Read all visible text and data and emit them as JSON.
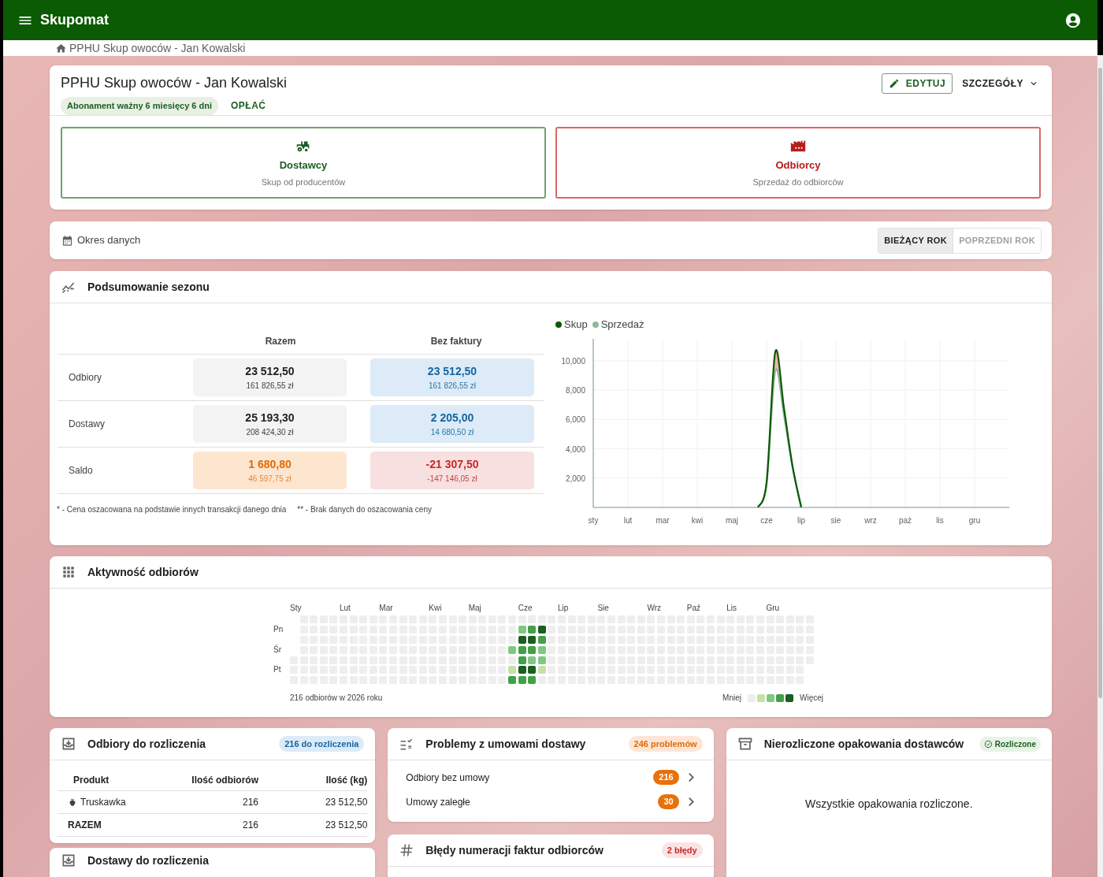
{
  "app_bar": {
    "title": "Skupomat"
  },
  "breadcrumb": {
    "label": "PPHU Skup owoców - Jan Kowalski"
  },
  "company": {
    "name": "PPHU Skup owoców - Jan Kowalski",
    "subscription_badge": "Abonament ważny 6 miesięcy 6 dni",
    "pay_button": "OPŁAĆ",
    "edit_button": "EDYTUJ",
    "details_button": "SZCZEGÓŁY"
  },
  "tiles": [
    {
      "kind": "suppliers",
      "title": "Dostawcy",
      "subtitle": "Skup od producentów"
    },
    {
      "kind": "buyers",
      "title": "Odbiorcy",
      "subtitle": "Sprzedaż do odbiorców"
    }
  ],
  "period": {
    "label": "Okres danych",
    "options": [
      {
        "label": "BIEŻĄCY ROK",
        "selected": true
      },
      {
        "label": "POPRZEDNI ROK",
        "selected": false
      }
    ]
  },
  "season_summary": {
    "title": "Podsumowanie sezonu",
    "columns": [
      "Razem",
      "Bez faktury"
    ],
    "rows": [
      {
        "label": "Odbiory",
        "cells": [
          {
            "kind": "neutral",
            "amount": "23 512,50",
            "value": "161 826,55 zł"
          },
          {
            "kind": "info",
            "amount": "23 512,50",
            "value": "161 826,55 zł"
          }
        ]
      },
      {
        "label": "Dostawy",
        "cells": [
          {
            "kind": "neutral",
            "amount": "25 193,30",
            "value": "208 424,30 zł"
          },
          {
            "kind": "info",
            "amount": "2 205,00",
            "value": "14 680,50 zł"
          }
        ]
      },
      {
        "label": "Saldo",
        "cells": [
          {
            "kind": "warning",
            "amount": "1 680,80",
            "value": "46 597,75 zł"
          },
          {
            "kind": "error",
            "amount": "-21 307,50",
            "value": "-147 146,05 zł"
          }
        ]
      }
    ],
    "footnotes": [
      "* - Cena oszacowana na podstawie innych transakcji danego dnia",
      "** - Brak danych do oszacowania ceny"
    ],
    "chart_data": {
      "type": "line",
      "grid": true,
      "legend": "top-left",
      "ylim": [
        0,
        11500
      ],
      "categories": [
        "sty",
        null,
        null,
        null,
        "lut",
        null,
        null,
        null,
        "mar",
        null,
        null,
        null,
        "kwi",
        null,
        null,
        null,
        "maj",
        null,
        null,
        null,
        "cze",
        null,
        null,
        null,
        "lip",
        null,
        null,
        null,
        "sie",
        null,
        null,
        null,
        "wrz",
        null,
        null,
        null,
        "paż",
        null,
        null,
        null,
        "lis",
        null,
        null,
        null,
        "gru",
        null,
        null,
        null
      ],
      "yticks": [
        {
          "value": 2000,
          "label": "2,000"
        },
        {
          "value": 4000,
          "label": "4,000"
        },
        {
          "value": 6000,
          "label": "6,000"
        },
        {
          "value": 8000,
          "label": "8,000"
        },
        {
          "value": 10000,
          "label": "10,000"
        }
      ],
      "series": [
        {
          "name": "Skup",
          "color": "#0b5a04",
          "values": [
            null,
            null,
            null,
            null,
            null,
            null,
            null,
            null,
            null,
            null,
            null,
            null,
            null,
            null,
            null,
            null,
            null,
            null,
            null,
            0,
            1700,
            10600,
            6800,
            2800,
            0,
            null,
            null,
            null,
            null,
            null,
            null,
            null,
            null,
            null,
            null,
            null,
            null,
            null,
            null,
            null,
            null,
            null,
            null,
            null,
            null,
            null,
            null,
            null
          ]
        },
        {
          "name": "Sprzedaż",
          "color": "#8fb89a",
          "values": [
            null,
            null,
            null,
            null,
            null,
            null,
            null,
            null,
            null,
            null,
            null,
            null,
            null,
            null,
            null,
            null,
            null,
            null,
            null,
            0,
            1600,
            9300,
            6300,
            2700,
            0,
            null,
            null,
            null,
            null,
            null,
            null,
            null,
            null,
            null,
            null,
            null,
            null,
            null,
            null,
            null,
            null,
            null,
            null,
            null,
            null,
            null,
            null,
            null
          ]
        }
      ]
    }
  },
  "activity": {
    "title": "Aktywność odbiorów",
    "months": [
      "Sty",
      "Lut",
      "Mar",
      "Kwi",
      "Maj",
      "Cze",
      "Lip",
      "Sie",
      "Wrz",
      "Paź",
      "Lis",
      "Gru"
    ],
    "day_labels": [
      "Pn",
      "Śr",
      "Pt"
    ],
    "grid": [
      {
        "cells": [
          {
            "color": "#eeeeee"
          },
          {
            "color": "#eeeeee"
          },
          {
            "color": "#eeeeee"
          },
          {
            "color": "#eeeeee"
          },
          {
            "color": "#eeeeee"
          },
          {
            "color": "#eeeeee"
          },
          {
            "color": "#eeeeee"
          },
          {
            "color": "#eeeeee"
          },
          {
            "color": "#eeeeee"
          },
          {
            "color": "#eeeeee"
          },
          {
            "color": "#eeeeee"
          },
          {
            "color": "#eeeeee"
          },
          {
            "color": "#eeeeee"
          },
          {
            "color": "#eeeeee"
          },
          {
            "color": "#eeeeee"
          },
          {
            "color": "#eeeeee"
          },
          {
            "color": "#eeeeee"
          },
          {
            "color": "#eeeeee"
          },
          {
            "color": "#eeeeee"
          },
          {
            "color": "#eeeeee"
          },
          {
            "color": "#eeeeee"
          },
          {
            "color": "#eeeeee"
          },
          {
            "color": "#eeeeee"
          },
          {
            "color": "#eeeeee"
          },
          {
            "color": "#eeeeee"
          },
          {
            "color": "#eeeeee"
          },
          {
            "color": "#eeeeee"
          },
          {
            "color": "#eeeeee"
          },
          {
            "color": "#eeeeee"
          },
          {
            "color": "#eeeeee"
          },
          {
            "color": "#eeeeee"
          },
          {
            "color": "#eeeeee"
          },
          {
            "color": "#eeeeee"
          },
          {
            "color": "#eeeeee"
          },
          {
            "color": "#eeeeee"
          },
          {
            "color": "#eeeeee"
          },
          {
            "color": "#eeeeee"
          },
          {
            "color": "#eeeeee"
          },
          {
            "color": "#eeeeee"
          },
          {
            "color": "#eeeeee"
          },
          {
            "color": "#eeeeee"
          },
          {
            "color": "#eeeeee"
          },
          {
            "color": "#eeeeee"
          },
          {
            "color": "#eeeeee"
          },
          {
            "color": "#eeeeee"
          },
          {
            "color": "#eeeeee"
          },
          {
            "color": "#eeeeee"
          },
          {
            "color": "#eeeeee"
          },
          {
            "color": "#eeeeee"
          },
          {
            "color": "#eeeeee"
          },
          {
            "color": "#eeeeee"
          },
          {
            "color": "#eeeeee"
          }
        ]
      },
      {
        "cells": [
          {
            "color": "#eeeeee"
          },
          {
            "color": "#eeeeee"
          },
          {
            "color": "#eeeeee"
          },
          {
            "color": "#eeeeee"
          },
          {
            "color": "#eeeeee"
          },
          {
            "color": "#eeeeee"
          },
          {
            "color": "#eeeeee"
          },
          {
            "color": "#eeeeee"
          },
          {
            "color": "#eeeeee"
          },
          {
            "color": "#eeeeee"
          },
          {
            "color": "#eeeeee"
          },
          {
            "color": "#eeeeee"
          },
          {
            "color": "#eeeeee"
          },
          {
            "color": "#eeeeee"
          },
          {
            "color": "#eeeeee"
          },
          {
            "color": "#eeeeee"
          },
          {
            "color": "#eeeeee"
          },
          {
            "color": "#eeeeee"
          },
          {
            "color": "#eeeeee"
          },
          {
            "color": "#eeeeee"
          },
          {
            "color": "#eeeeee"
          },
          {
            "color": "#eeeeee"
          },
          {
            "color": "#81c784"
          },
          {
            "color": "#43a047"
          },
          {
            "color": "#1b5e20"
          },
          {
            "color": "#eeeeee"
          },
          {
            "color": "#eeeeee"
          },
          {
            "color": "#eeeeee"
          },
          {
            "color": "#eeeeee"
          },
          {
            "color": "#eeeeee"
          },
          {
            "color": "#eeeeee"
          },
          {
            "color": "#eeeeee"
          },
          {
            "color": "#eeeeee"
          },
          {
            "color": "#eeeeee"
          },
          {
            "color": "#eeeeee"
          },
          {
            "color": "#eeeeee"
          },
          {
            "color": "#eeeeee"
          },
          {
            "color": "#eeeeee"
          },
          {
            "color": "#eeeeee"
          },
          {
            "color": "#eeeeee"
          },
          {
            "color": "#eeeeee"
          },
          {
            "color": "#eeeeee"
          },
          {
            "color": "#eeeeee"
          },
          {
            "color": "#eeeeee"
          },
          {
            "color": "#eeeeee"
          },
          {
            "color": "#eeeeee"
          },
          {
            "color": "#eeeeee"
          },
          {
            "color": "#eeeeee"
          },
          {
            "color": "#eeeeee"
          },
          {
            "color": "#eeeeee"
          },
          {
            "color": "#eeeeee"
          },
          {
            "color": "#eeeeee"
          }
        ]
      },
      {
        "cells": [
          {
            "color": "#eeeeee"
          },
          {
            "color": "#eeeeee"
          },
          {
            "color": "#eeeeee"
          },
          {
            "color": "#eeeeee"
          },
          {
            "color": "#eeeeee"
          },
          {
            "color": "#eeeeee"
          },
          {
            "color": "#eeeeee"
          },
          {
            "color": "#eeeeee"
          },
          {
            "color": "#eeeeee"
          },
          {
            "color": "#eeeeee"
          },
          {
            "color": "#eeeeee"
          },
          {
            "color": "#eeeeee"
          },
          {
            "color": "#eeeeee"
          },
          {
            "color": "#eeeeee"
          },
          {
            "color": "#eeeeee"
          },
          {
            "color": "#eeeeee"
          },
          {
            "color": "#eeeeee"
          },
          {
            "color": "#eeeeee"
          },
          {
            "color": "#eeeeee"
          },
          {
            "color": "#eeeeee"
          },
          {
            "color": "#eeeeee"
          },
          {
            "color": "#eeeeee"
          },
          {
            "color": "#1b5e20"
          },
          {
            "color": "#1b5e20"
          },
          {
            "color": "#43a047"
          },
          {
            "color": "#eeeeee"
          },
          {
            "color": "#eeeeee"
          },
          {
            "color": "#eeeeee"
          },
          {
            "color": "#eeeeee"
          },
          {
            "color": "#eeeeee"
          },
          {
            "color": "#eeeeee"
          },
          {
            "color": "#eeeeee"
          },
          {
            "color": "#eeeeee"
          },
          {
            "color": "#eeeeee"
          },
          {
            "color": "#eeeeee"
          },
          {
            "color": "#eeeeee"
          },
          {
            "color": "#eeeeee"
          },
          {
            "color": "#eeeeee"
          },
          {
            "color": "#eeeeee"
          },
          {
            "color": "#eeeeee"
          },
          {
            "color": "#eeeeee"
          },
          {
            "color": "#eeeeee"
          },
          {
            "color": "#eeeeee"
          },
          {
            "color": "#eeeeee"
          },
          {
            "color": "#eeeeee"
          },
          {
            "color": "#eeeeee"
          },
          {
            "color": "#eeeeee"
          },
          {
            "color": "#eeeeee"
          },
          {
            "color": "#eeeeee"
          },
          {
            "color": "#eeeeee"
          },
          {
            "color": "#eeeeee"
          },
          {
            "color": "#eeeeee"
          }
        ]
      },
      {
        "cells": [
          {
            "color": "#eeeeee"
          },
          {
            "color": "#eeeeee"
          },
          {
            "color": "#eeeeee"
          },
          {
            "color": "#eeeeee"
          },
          {
            "color": "#eeeeee"
          },
          {
            "color": "#eeeeee"
          },
          {
            "color": "#eeeeee"
          },
          {
            "color": "#eeeeee"
          },
          {
            "color": "#eeeeee"
          },
          {
            "color": "#eeeeee"
          },
          {
            "color": "#eeeeee"
          },
          {
            "color": "#eeeeee"
          },
          {
            "color": "#eeeeee"
          },
          {
            "color": "#eeeeee"
          },
          {
            "color": "#eeeeee"
          },
          {
            "color": "#eeeeee"
          },
          {
            "color": "#eeeeee"
          },
          {
            "color": "#eeeeee"
          },
          {
            "color": "#eeeeee"
          },
          {
            "color": "#eeeeee"
          },
          {
            "color": "#eeeeee"
          },
          {
            "color": "#81c784"
          },
          {
            "color": "#43a047"
          },
          {
            "color": "#43a047"
          },
          {
            "color": "#81c784"
          },
          {
            "color": "#eeeeee"
          },
          {
            "color": "#eeeeee"
          },
          {
            "color": "#eeeeee"
          },
          {
            "color": "#eeeeee"
          },
          {
            "color": "#eeeeee"
          },
          {
            "color": "#eeeeee"
          },
          {
            "color": "#eeeeee"
          },
          {
            "color": "#eeeeee"
          },
          {
            "color": "#eeeeee"
          },
          {
            "color": "#eeeeee"
          },
          {
            "color": "#eeeeee"
          },
          {
            "color": "#eeeeee"
          },
          {
            "color": "#eeeeee"
          },
          {
            "color": "#eeeeee"
          },
          {
            "color": "#eeeeee"
          },
          {
            "color": "#eeeeee"
          },
          {
            "color": "#eeeeee"
          },
          {
            "color": "#eeeeee"
          },
          {
            "color": "#eeeeee"
          },
          {
            "color": "#eeeeee"
          },
          {
            "color": "#eeeeee"
          },
          {
            "color": "#eeeeee"
          },
          {
            "color": "#eeeeee"
          },
          {
            "color": "#eeeeee"
          },
          {
            "color": "#eeeeee"
          },
          {
            "color": "#eeeeee"
          },
          {
            "color": "#eeeeee"
          }
        ]
      },
      {
        "cells": [
          {
            "color": "#eeeeee"
          },
          {
            "color": "#eeeeee"
          },
          {
            "color": "#eeeeee"
          },
          {
            "color": "#eeeeee"
          },
          {
            "color": "#eeeeee"
          },
          {
            "color": "#eeeeee"
          },
          {
            "color": "#eeeeee"
          },
          {
            "color": "#eeeeee"
          },
          {
            "color": "#eeeeee"
          },
          {
            "color": "#eeeeee"
          },
          {
            "color": "#eeeeee"
          },
          {
            "color": "#eeeeee"
          },
          {
            "color": "#eeeeee"
          },
          {
            "color": "#eeeeee"
          },
          {
            "color": "#eeeeee"
          },
          {
            "color": "#eeeeee"
          },
          {
            "color": "#eeeeee"
          },
          {
            "color": "#eeeeee"
          },
          {
            "color": "#eeeeee"
          },
          {
            "color": "#eeeeee"
          },
          {
            "color": "#eeeeee"
          },
          {
            "color": "#eeeeee"
          },
          {
            "color": "#eeeeee"
          },
          {
            "color": "#43a047"
          },
          {
            "color": "#81c784"
          },
          {
            "color": "#81c784"
          },
          {
            "color": "#eeeeee"
          },
          {
            "color": "#eeeeee"
          },
          {
            "color": "#eeeeee"
          },
          {
            "color": "#eeeeee"
          },
          {
            "color": "#eeeeee"
          },
          {
            "color": "#eeeeee"
          },
          {
            "color": "#eeeeee"
          },
          {
            "color": "#eeeeee"
          },
          {
            "color": "#eeeeee"
          },
          {
            "color": "#eeeeee"
          },
          {
            "color": "#eeeeee"
          },
          {
            "color": "#eeeeee"
          },
          {
            "color": "#eeeeee"
          },
          {
            "color": "#eeeeee"
          },
          {
            "color": "#eeeeee"
          },
          {
            "color": "#eeeeee"
          },
          {
            "color": "#eeeeee"
          },
          {
            "color": "#eeeeee"
          },
          {
            "color": "#eeeeee"
          },
          {
            "color": "#eeeeee"
          },
          {
            "color": "#eeeeee"
          },
          {
            "color": "#eeeeee"
          },
          {
            "color": "#eeeeee"
          },
          {
            "color": "#eeeeee"
          },
          {
            "color": "#eeeeee"
          },
          {
            "color": "#eeeeee"
          },
          {
            "color": "#eeeeee"
          }
        ]
      },
      {
        "cells": [
          {
            "color": "#eeeeee"
          },
          {
            "color": "#eeeeee"
          },
          {
            "color": "#eeeeee"
          },
          {
            "color": "#eeeeee"
          },
          {
            "color": "#eeeeee"
          },
          {
            "color": "#eeeeee"
          },
          {
            "color": "#eeeeee"
          },
          {
            "color": "#eeeeee"
          },
          {
            "color": "#eeeeee"
          },
          {
            "color": "#eeeeee"
          },
          {
            "color": "#eeeeee"
          },
          {
            "color": "#eeeeee"
          },
          {
            "color": "#eeeeee"
          },
          {
            "color": "#eeeeee"
          },
          {
            "color": "#eeeeee"
          },
          {
            "color": "#eeeeee"
          },
          {
            "color": "#eeeeee"
          },
          {
            "color": "#eeeeee"
          },
          {
            "color": "#eeeeee"
          },
          {
            "color": "#eeeeee"
          },
          {
            "color": "#eeeeee"
          },
          {
            "color": "#eeeeee"
          },
          {
            "color": "#c5e1a5"
          },
          {
            "color": "#1b5e20"
          },
          {
            "color": "#1b5e20"
          },
          {
            "color": "#c5e1a5"
          },
          {
            "color": "#eeeeee"
          },
          {
            "color": "#eeeeee"
          },
          {
            "color": "#eeeeee"
          },
          {
            "color": "#eeeeee"
          },
          {
            "color": "#eeeeee"
          },
          {
            "color": "#eeeeee"
          },
          {
            "color": "#eeeeee"
          },
          {
            "color": "#eeeeee"
          },
          {
            "color": "#eeeeee"
          },
          {
            "color": "#eeeeee"
          },
          {
            "color": "#eeeeee"
          },
          {
            "color": "#eeeeee"
          },
          {
            "color": "#eeeeee"
          },
          {
            "color": "#eeeeee"
          },
          {
            "color": "#eeeeee"
          },
          {
            "color": "#eeeeee"
          },
          {
            "color": "#eeeeee"
          },
          {
            "color": "#eeeeee"
          },
          {
            "color": "#eeeeee"
          },
          {
            "color": "#eeeeee"
          },
          {
            "color": "#eeeeee"
          },
          {
            "color": "#eeeeee"
          },
          {
            "color": "#eeeeee"
          },
          {
            "color": "#eeeeee"
          },
          {
            "color": "#eeeeee"
          },
          {
            "color": "#eeeeee"
          }
        ]
      },
      {
        "cells": [
          {
            "color": "#eeeeee"
          },
          {
            "color": "#eeeeee"
          },
          {
            "color": "#eeeeee"
          },
          {
            "color": "#eeeeee"
          },
          {
            "color": "#eeeeee"
          },
          {
            "color": "#eeeeee"
          },
          {
            "color": "#eeeeee"
          },
          {
            "color": "#eeeeee"
          },
          {
            "color": "#eeeeee"
          },
          {
            "color": "#eeeeee"
          },
          {
            "color": "#eeeeee"
          },
          {
            "color": "#eeeeee"
          },
          {
            "color": "#eeeeee"
          },
          {
            "color": "#eeeeee"
          },
          {
            "color": "#eeeeee"
          },
          {
            "color": "#eeeeee"
          },
          {
            "color": "#eeeeee"
          },
          {
            "color": "#eeeeee"
          },
          {
            "color": "#eeeeee"
          },
          {
            "color": "#eeeeee"
          },
          {
            "color": "#eeeeee"
          },
          {
            "color": "#eeeeee"
          },
          {
            "color": "#43a047"
          },
          {
            "color": "#43a047"
          },
          {
            "color": "#43a047"
          },
          {
            "color": "#eeeeee"
          },
          {
            "color": "#eeeeee"
          },
          {
            "color": "#eeeeee"
          },
          {
            "color": "#eeeeee"
          },
          {
            "color": "#eeeeee"
          },
          {
            "color": "#eeeeee"
          },
          {
            "color": "#eeeeee"
          },
          {
            "color": "#eeeeee"
          },
          {
            "color": "#eeeeee"
          },
          {
            "color": "#eeeeee"
          },
          {
            "color": "#eeeeee"
          },
          {
            "color": "#eeeeee"
          },
          {
            "color": "#eeeeee"
          },
          {
            "color": "#eeeeee"
          },
          {
            "color": "#eeeeee"
          },
          {
            "color": "#eeeeee"
          },
          {
            "color": "#eeeeee"
          },
          {
            "color": "#eeeeee"
          },
          {
            "color": "#eeeeee"
          },
          {
            "color": "#eeeeee"
          },
          {
            "color": "#eeeeee"
          },
          {
            "color": "#eeeeee"
          },
          {
            "color": "#eeeeee"
          },
          {
            "color": "#eeeeee"
          },
          {
            "color": "#eeeeee"
          },
          {
            "color": "#eeeeee"
          },
          {
            "color": "#eeeeee"
          }
        ]
      }
    ],
    "total": "216 odbiorów w 2026 roku",
    "legend_less": "Mniej",
    "legend_more": "Więcej"
  },
  "settlement": {
    "title": "Odbiory do rozliczenia",
    "badge": "216 do rozliczenia",
    "columns": [
      "Produkt",
      "Ilość odbiorów",
      "Ilość (kg)"
    ],
    "rows": [
      {
        "product": "Truskawka",
        "count": "216",
        "kg": "23 512,50"
      }
    ],
    "total": {
      "label": "RAZEM",
      "count": "216",
      "kg": "23 512,50"
    }
  },
  "deliveries_settlement": {
    "title": "Dostawy do rozliczenia"
  },
  "contract_problems": {
    "title": "Problemy z umowami dostawy",
    "badge": "246 problemów",
    "items": [
      {
        "label": "Odbiory bez umowy",
        "count": "216"
      },
      {
        "label": "Umowy zaległe",
        "count": "30"
      }
    ]
  },
  "invoice_errors": {
    "title": "Błędy numeracji faktur odbiorców",
    "badge": "2 błędy"
  },
  "packaging": {
    "title": "Nierozliczone opakowania dostawców",
    "badge": "Rozliczone",
    "message": "Wszystkie opakowania rozliczone."
  }
}
